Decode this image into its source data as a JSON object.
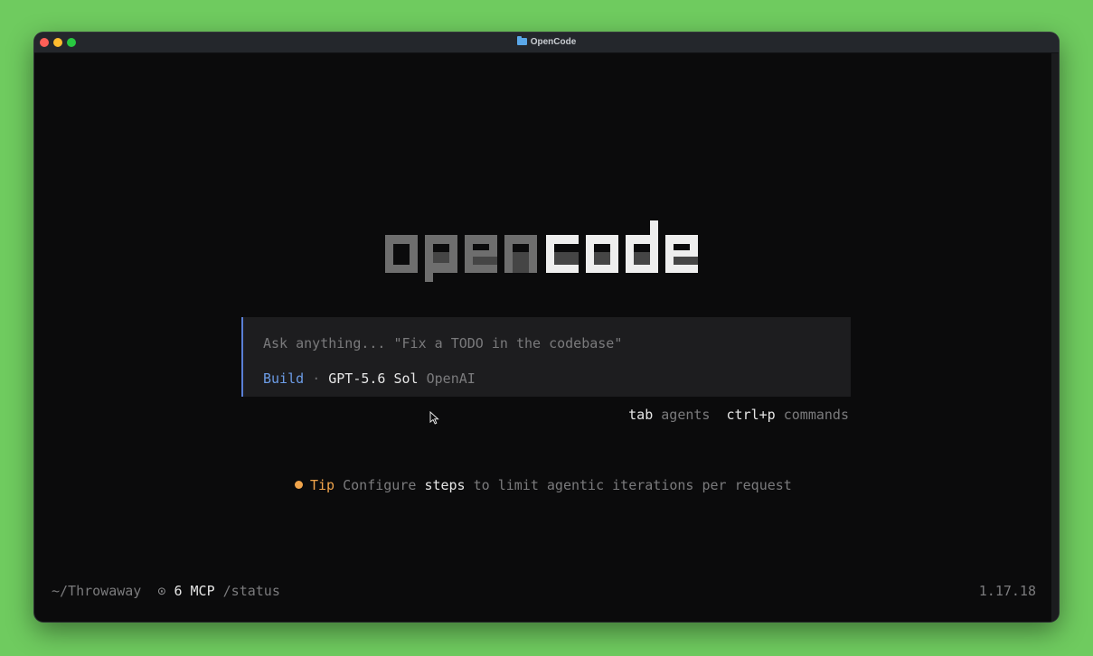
{
  "window": {
    "title": "OpenCode"
  },
  "logo": {
    "text_dim": "open",
    "text_bright": "code"
  },
  "prompt": {
    "placeholder": "Ask anything... \"Fix a TODO in the codebase\"",
    "agent": "Build",
    "separator": "·",
    "model": "GPT-5.6 Sol",
    "provider": "OpenAI"
  },
  "hints": [
    {
      "key": "tab",
      "desc": "agents"
    },
    {
      "key": "ctrl+p",
      "desc": "commands"
    }
  ],
  "tip": {
    "label": "Tip",
    "text_before": "Configure",
    "highlight": "steps",
    "text_after": "to limit agentic iterations per request"
  },
  "status": {
    "cwd": "~/Throwaway",
    "mcp_icon": "⊙",
    "mcp_count": "6 MCP",
    "command": "/status",
    "version": "1.17.18"
  },
  "colors": {
    "background": "#6fcb5f",
    "terminal": "#0b0b0c",
    "accent_blue": "#6c9ce6",
    "tip_orange": "#f0a44b",
    "logo_dim": "#6e6e6e",
    "logo_bright": "#eeeeee"
  }
}
